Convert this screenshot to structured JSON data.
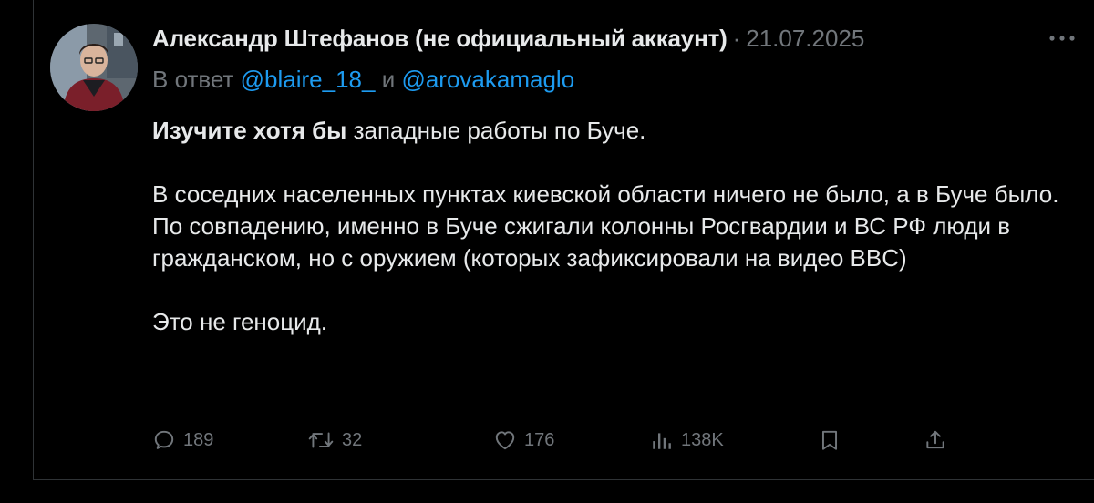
{
  "tweet": {
    "author_name": "Александр Штефанов (не официальный аккаунт)",
    "separator": "·",
    "date": "21.07.2025",
    "reply_prefix": "В ответ",
    "mention_1": "@blaire_18_",
    "reply_conjunction": "и",
    "mention_2": "@arovakamaglo",
    "paragraphs": {
      "p1_bold": "Изучите хотя бы",
      "p1_rest": " западные работы по Буче.",
      "p2": "В соседних населенных пунктах киевской области ничего не было, а в Буче было. По совпадению, именно в Буче сжигали колонны Росгвардии и ВС РФ люди в гражданском, но с оружием (которых зафиксировали на видео BBC)",
      "p3": "Это не геноцид."
    }
  },
  "actions": {
    "replies": "189",
    "retweets": "32",
    "likes": "176",
    "views": "138K"
  },
  "icons": {
    "reply": "reply-icon",
    "retweet": "retweet-icon",
    "like": "heart-icon",
    "views": "views-icon",
    "bookmark": "bookmark-icon",
    "share": "share-icon",
    "more": "more-dots-icon"
  },
  "colors": {
    "background": "#000000",
    "text": "#e7e9ea",
    "muted": "#71767b",
    "link": "#1d9bf0",
    "border": "#2f3336"
  }
}
